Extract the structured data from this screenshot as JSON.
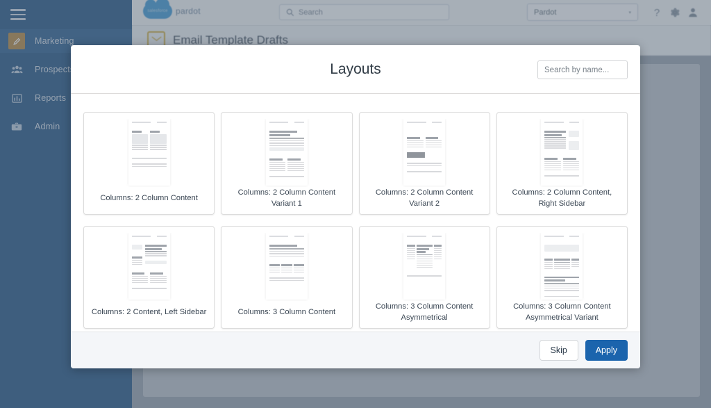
{
  "sidebar": {
    "menu_icon": "hamburger-icon",
    "items": [
      {
        "label": "Marketing",
        "icon": "pencil-icon",
        "active": true
      },
      {
        "label": "Prospects",
        "icon": "people-icon",
        "active": false
      },
      {
        "label": "Reports",
        "icon": "bar-chart-icon",
        "active": false
      },
      {
        "label": "Admin",
        "icon": "briefcase-icon",
        "active": false
      }
    ]
  },
  "topbar": {
    "brand_cloud_text": "salesforce",
    "brand_word": "pardot",
    "search_placeholder": "Search",
    "search_icon": "search-icon",
    "app_picker_value": "Pardot",
    "app_picker_caret": "▾",
    "help_icon": "question-mark-icon",
    "setup_icon": "gear-icon",
    "user_icon": "user-avatar-icon"
  },
  "page_header": {
    "title": "Email Template Drafts",
    "icon": "envelope-icon"
  },
  "modal": {
    "title": "Layouts",
    "search": {
      "placeholder": "Search by name...",
      "value": ""
    },
    "layouts": [
      {
        "name": "Columns: 2 Column Content",
        "thumb": "two-col-content"
      },
      {
        "name": "Columns: 2 Column Content Variant 1",
        "thumb": "two-col-variant-1"
      },
      {
        "name": "Columns: 2 Column Content Variant 2",
        "thumb": "two-col-variant-2"
      },
      {
        "name": "Columns: 2 Column Content, Right Sidebar",
        "thumb": "two-col-right-sidebar"
      },
      {
        "name": "Columns: 2 Content, Left Sidebar",
        "thumb": "two-col-left-sidebar"
      },
      {
        "name": "Columns: 3 Column Content",
        "thumb": "three-col-content"
      },
      {
        "name": "Columns: 3 Column Content Asymmetrical",
        "thumb": "three-col-asym"
      },
      {
        "name": "Columns: 3 Column Content Asymmetrical Variant",
        "thumb": "three-col-asym-variant"
      }
    ],
    "footer": {
      "skip_label": "Skip",
      "apply_label": "Apply"
    }
  },
  "colors": {
    "sidebar_blue": "#0d4379",
    "sidebar_active": "#154e86",
    "active_icon_gold": "#b07d2d",
    "brand_blue": "#1b64ad",
    "scrim": "#687584",
    "page_bg": "#8e99a6",
    "envelope_gold": "#c9a227"
  }
}
